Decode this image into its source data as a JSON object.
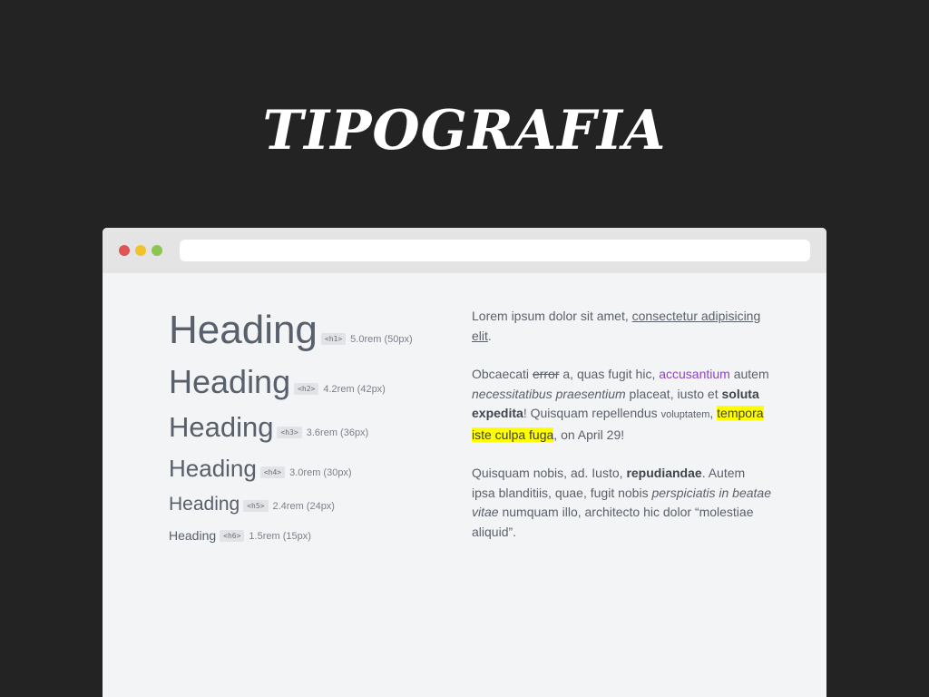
{
  "slide": {
    "title": "TIPOGRAFIA"
  },
  "browser": {
    "window_controls": [
      "close",
      "minimize",
      "maximize"
    ],
    "address_bar_value": ""
  },
  "headings": [
    {
      "text": "Heading",
      "tag": "<h1>",
      "size": "5.0rem (50px)"
    },
    {
      "text": "Heading",
      "tag": "<h2>",
      "size": "4.2rem (42px)"
    },
    {
      "text": "Heading",
      "tag": "<h3>",
      "size": "3.6rem (36px)"
    },
    {
      "text": "Heading",
      "tag": "<h4>",
      "size": "3.0rem (30px)"
    },
    {
      "text": "Heading",
      "tag": "<h5>",
      "size": "2.4rem (24px)"
    },
    {
      "text": "Heading",
      "tag": "<h6>",
      "size": "1.5rem (15px)"
    }
  ],
  "prose": {
    "p1": {
      "a": "Lorem ipsum dolor sit amet, ",
      "link": "consectetur adipisicing elit",
      "b": "."
    },
    "p2": {
      "a": "Obcaecati ",
      "strike": "error",
      "b": " a, quas fugit hic, ",
      "colored": "accusantium",
      "c": " autem ",
      "italic1": "necessitatibus praesentium",
      "d": " placeat, iusto et ",
      "bold": "soluta expedita",
      "e": "! Quisquam repellendus ",
      "small": "voluptatem",
      "f": ", ",
      "highlight": "tempora iste culpa fuga",
      "g": ", on April 29!"
    },
    "p3": {
      "a": "Quisquam nobis, ad. Iusto, ",
      "bold": "repudiandae",
      "b": ". Autem ipsa blanditiis, quae, fugit nobis ",
      "italic": "perspiciatis in beatae vitae",
      "c": " numquam illo, architecto hic dolor “molestiae aliquid”."
    }
  },
  "colors": {
    "page_background": "#232323",
    "browser_background": "#f3f4f6",
    "close_dot": "#dd5554",
    "minimize_dot": "#f2c12e",
    "maximize_dot": "#8ec552",
    "link_purple": "#8e44c4",
    "highlight_yellow": "#ffff00"
  }
}
